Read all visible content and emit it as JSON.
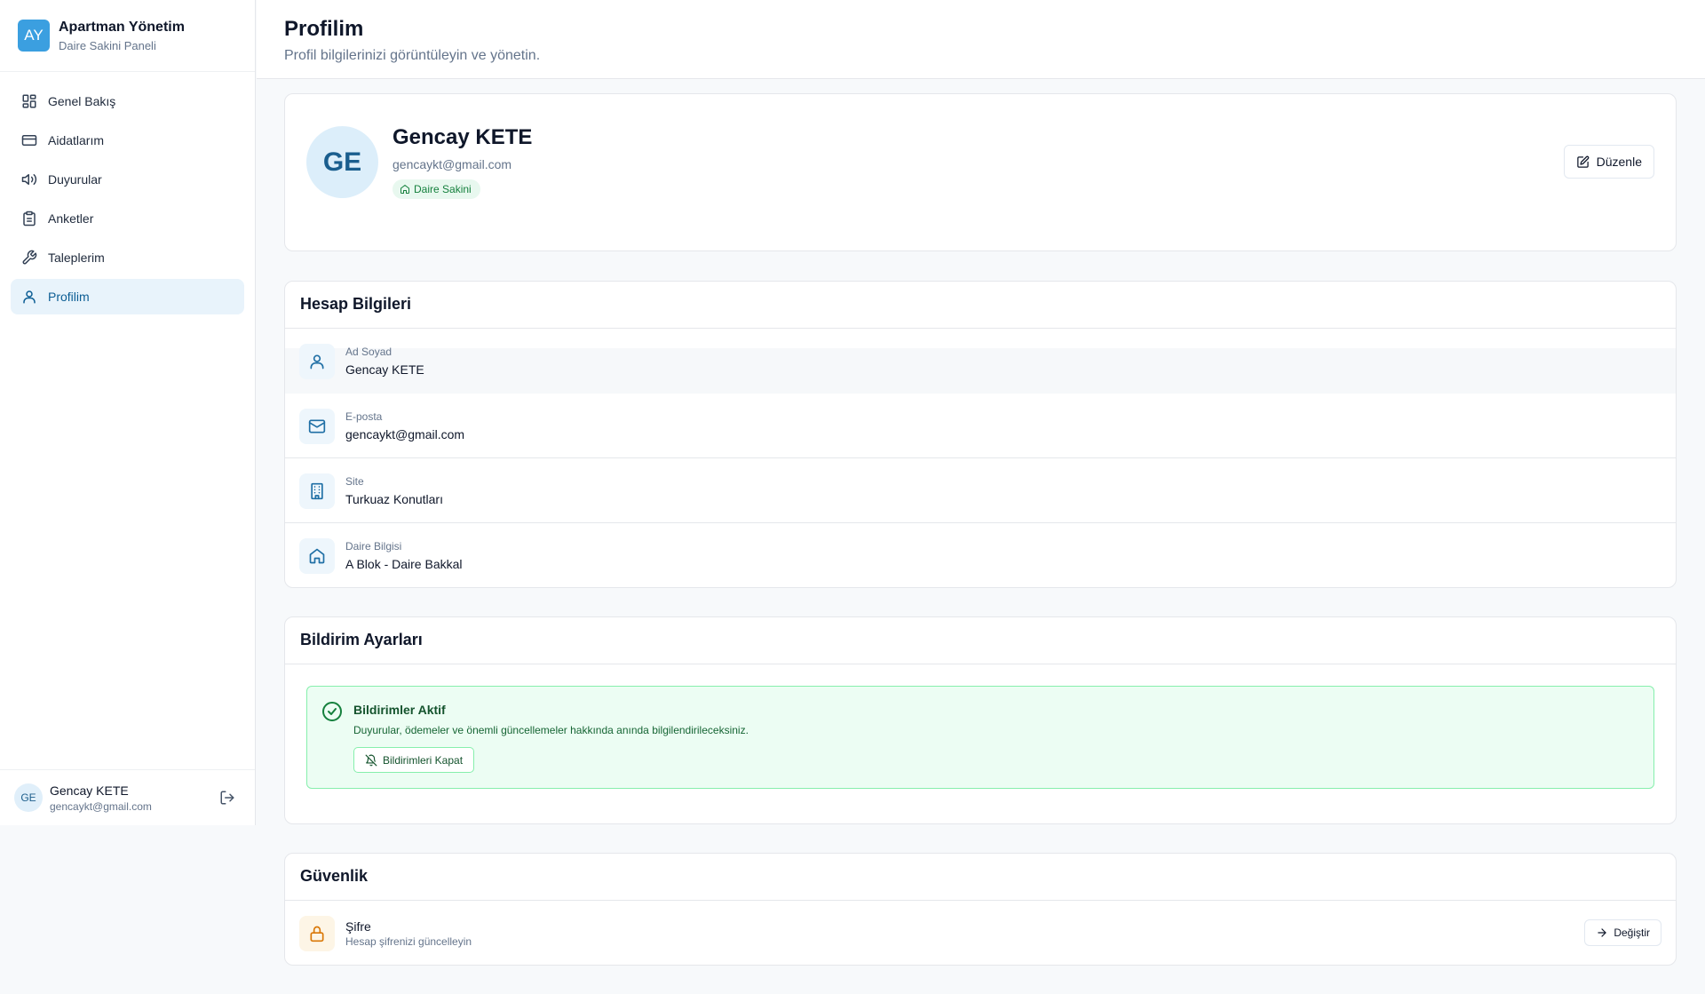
{
  "brand": {
    "logo_text": "AY",
    "title": "Apartman Yönetim",
    "subtitle": "Daire Sakini Paneli"
  },
  "sidebar": {
    "items": [
      {
        "label": "Genel Bakış",
        "icon": "grid-icon"
      },
      {
        "label": "Aidatlarım",
        "icon": "credit-card-icon"
      },
      {
        "label": "Duyurular",
        "icon": "megaphone-icon"
      },
      {
        "label": "Anketler",
        "icon": "clipboard-icon"
      },
      {
        "label": "Taleplerim",
        "icon": "wrench-icon"
      },
      {
        "label": "Profilim",
        "icon": "user-icon"
      }
    ],
    "active_index": 5
  },
  "current_user": {
    "initials": "GE",
    "name": "Gencay KETE",
    "email": "gencaykt@gmail.com"
  },
  "header": {
    "title": "Profilim",
    "subtitle": "Profil bilgilerinizi görüntüleyin ve yönetin."
  },
  "profile": {
    "initials": "GE",
    "name": "Gencay KETE",
    "email": "gencaykt@gmail.com",
    "role": "Daire Sakini",
    "edit_label": "Düzenle"
  },
  "account": {
    "title": "Hesap Bilgileri",
    "rows": [
      {
        "label": "Ad Soyad",
        "value": "Gencay KETE",
        "icon": "user-icon"
      },
      {
        "label": "E-posta",
        "value": "gencaykt@gmail.com",
        "icon": "mail-icon"
      },
      {
        "label": "Site",
        "value": "Turkuaz Konutları",
        "icon": "building-icon"
      },
      {
        "label": "Daire Bilgisi",
        "value": "A Blok - Daire Bakkal",
        "icon": "home-icon"
      }
    ]
  },
  "notifications": {
    "title": "Bildirim Ayarları",
    "status_title": "Bildirimler Aktif",
    "status_desc": "Duyurular, ödemeler ve önemli güncellemeler hakkında anında bilgilendirileceksiniz.",
    "button_label": "Bildirimleri Kapat"
  },
  "security": {
    "title": "Güvenlik",
    "password_title": "Şifre",
    "password_sub": "Hesap şifrenizi güncelleyin",
    "button_label": "Değiştir"
  },
  "colors": {
    "accent": "#0b5d94",
    "success": "#15803d",
    "warning": "#d97706"
  }
}
